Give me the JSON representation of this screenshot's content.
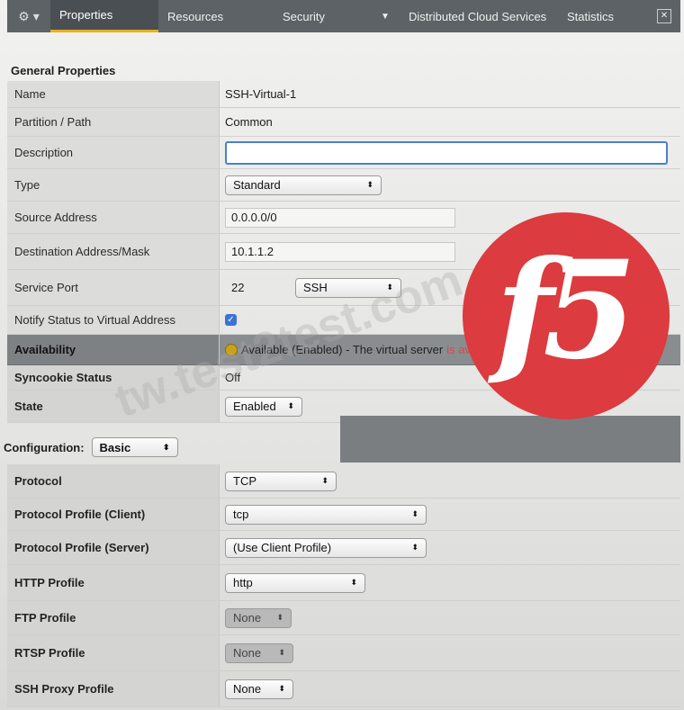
{
  "tabs": [
    {
      "label": "Properties",
      "active": true
    },
    {
      "label": "Resources",
      "active": false
    },
    {
      "label": "Security",
      "active": false
    },
    {
      "label": "Distributed Cloud Services",
      "active": false
    },
    {
      "label": "Statistics",
      "active": false
    }
  ],
  "sections": {
    "general": "General Properties",
    "configuration": "Configuration:"
  },
  "general": {
    "name": {
      "label": "Name",
      "value": "SSH-Virtual-1"
    },
    "partition": {
      "label": "Partition / Path",
      "value": "Common"
    },
    "description": {
      "label": "Description",
      "value": ""
    },
    "type": {
      "label": "Type",
      "value": "Standard"
    },
    "source": {
      "label": "Source Address",
      "value": "0.0.0.0/0"
    },
    "destination": {
      "label": "Destination Address/Mask",
      "value": "10.1.1.2"
    },
    "service_port": {
      "label": "Service Port",
      "value": "22",
      "protocol": "SSH"
    },
    "notify": {
      "label": "Notify Status to Virtual Address",
      "checked": true
    },
    "availability": {
      "label": "Availability",
      "value": "Available (Enabled) - The virtual server",
      "suffix": "is available"
    },
    "syncookie": {
      "label": "Syncookie Status",
      "value": "Off"
    },
    "state": {
      "label": "State",
      "value": "Enabled"
    }
  },
  "configuration": {
    "mode": "Basic",
    "protocol": {
      "label": "Protocol",
      "value": "TCP"
    },
    "client_profile": {
      "label": "Protocol Profile (Client)",
      "value": "tcp"
    },
    "server_profile": {
      "label": "Protocol Profile (Server)",
      "value": "(Use Client Profile)"
    },
    "http_profile": {
      "label": "HTTP Profile",
      "value": "http"
    },
    "ftp_profile": {
      "label": "FTP Profile",
      "value": "None"
    },
    "rtsp_profile": {
      "label": "RTSP Profile",
      "value": "None"
    },
    "ssh_profile": {
      "label": "SSH Proxy Profile",
      "value": "None"
    }
  },
  "watermark": {
    "text": "tw.test2test.com",
    "logo": "f5"
  },
  "colors": {
    "tab_active": "#e6b21d",
    "logo_red": "#dc3b3f",
    "focus_blue": "#4a7fd0"
  }
}
